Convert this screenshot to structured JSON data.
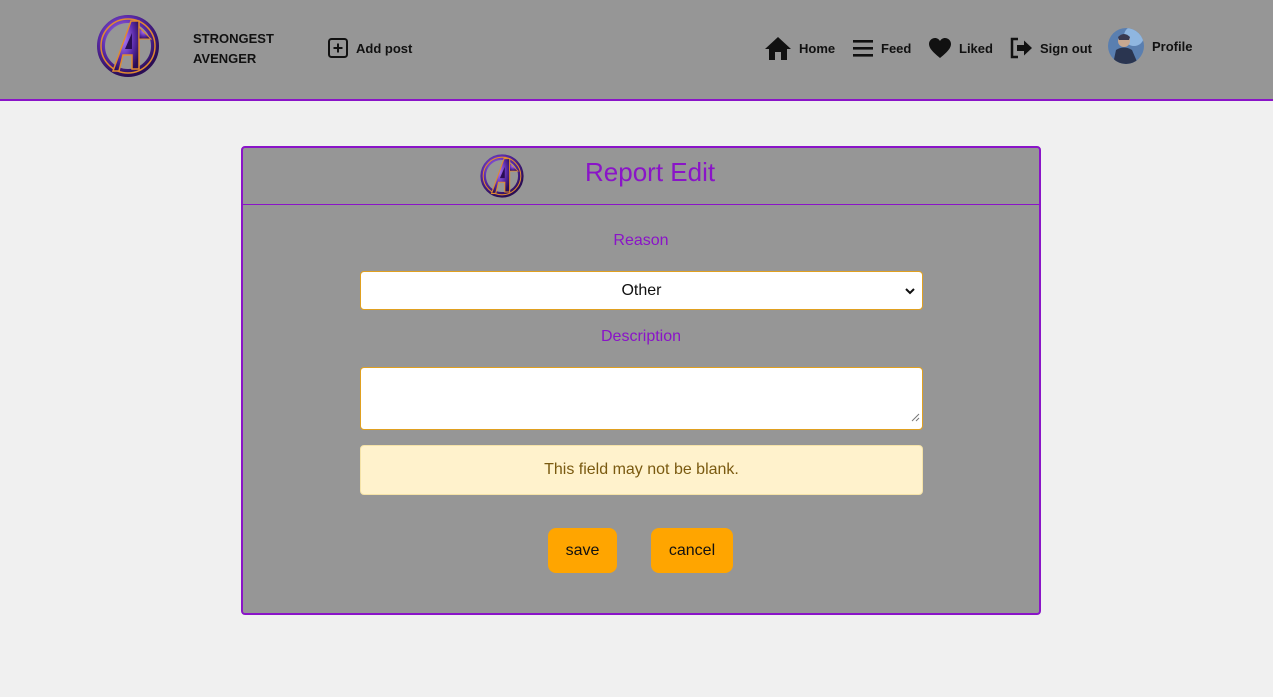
{
  "brand": {
    "name_line1": "STRONGEST",
    "name_line2": "AVENGER",
    "logo_icon": "avengers-logo-icon"
  },
  "nav": {
    "add_post": "Add post",
    "home": "Home",
    "feed": "Feed",
    "liked": "Liked",
    "sign_out": "Sign out",
    "profile": "Profile"
  },
  "form": {
    "title": "Report Edit",
    "reason_label": "Reason",
    "reason_value": "Other",
    "description_label": "Description",
    "description_value": "",
    "error": "This field may not be blank.",
    "save": "save",
    "cancel": "cancel"
  },
  "colors": {
    "accent": "#8a14c8",
    "button": "#ffa500",
    "panel": "#969696",
    "alert_bg": "#fff2cc"
  }
}
